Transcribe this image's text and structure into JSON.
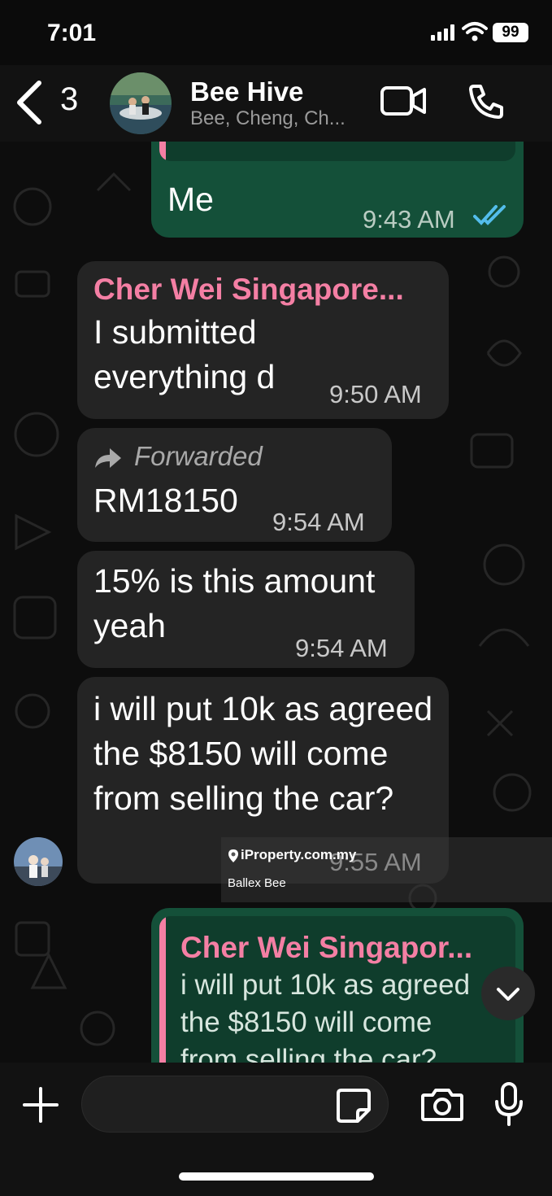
{
  "status_bar": {
    "time": "7:01",
    "battery": "99"
  },
  "header": {
    "back_count": "3",
    "title": "Bee Hive",
    "subtitle": "Bee, Cheng, Ch..."
  },
  "messages": [
    {
      "id": "m0",
      "direction": "outgoing",
      "text": "Me",
      "time": "9:43 AM",
      "read": true
    },
    {
      "id": "m1",
      "direction": "incoming",
      "sender": "Cher Wei Singapore...",
      "text": "I submitted everything d",
      "time": "9:50 AM"
    },
    {
      "id": "m2",
      "direction": "incoming",
      "forwarded_label": "Forwarded",
      "text": "RM18150",
      "time": "9:54 AM"
    },
    {
      "id": "m3",
      "direction": "incoming",
      "text": "15% is this amount yeah",
      "time": "9:54 AM"
    },
    {
      "id": "m4",
      "direction": "incoming",
      "text": "i will put 10k as agreed the $8150 will come from selling the car?",
      "time": "9:55 AM"
    },
    {
      "id": "m5",
      "direction": "outgoing",
      "quote_sender": "Cher Wei Singapor...",
      "quote_text": "i will put 10k as agreed the $8150 will come from selling the car?"
    }
  ],
  "watermark": {
    "site": "iProperty.com.my",
    "name": "Ballex Bee"
  },
  "icons": [
    "back-chevron",
    "video-call",
    "phone",
    "double-check",
    "forward-arrow",
    "chevron-down",
    "plus",
    "sticker",
    "camera",
    "microphone"
  ],
  "colors": {
    "sender": "#f47fa4",
    "outgoing_bubble": "#145039",
    "incoming_bubble": "#242424",
    "read_ticks": "#53bdeb"
  }
}
